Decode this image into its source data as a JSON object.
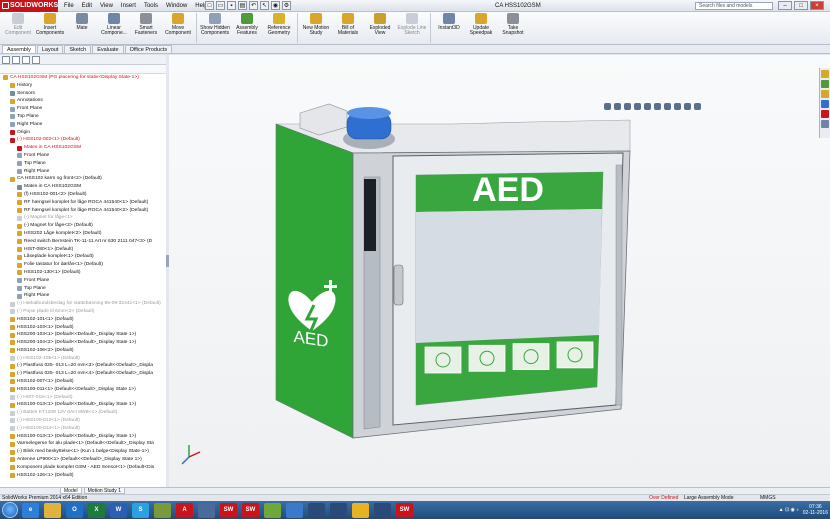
{
  "app": {
    "logo_text": "SOLIDWORKS",
    "document_title": "CA HSS102GSM",
    "search_placeholder": "Search files and models",
    "menus": [
      "File",
      "Edit",
      "View",
      "Insert",
      "Tools",
      "Window",
      "Help"
    ]
  },
  "ribbon": {
    "buttons": [
      {
        "label": "Edit Component",
        "icon": "edit-component-icon",
        "disabled": true,
        "color": "#c9ced6"
      },
      {
        "label": "Insert Components",
        "icon": "insert-components-icon",
        "disabled": false,
        "color": "#d9a52b"
      },
      {
        "label": "Mate",
        "icon": "mate-icon",
        "disabled": false,
        "color": "#7a8aa0"
      },
      {
        "label": "Linear Compone...",
        "icon": "linear-pattern-icon",
        "disabled": false,
        "color": "#6f86a8"
      },
      {
        "label": "Smart Fasteners",
        "icon": "smart-fasteners-icon",
        "disabled": false,
        "color": "#8a8f98"
      },
      {
        "label": "Move Component",
        "icon": "move-component-icon",
        "disabled": false,
        "color": "#d9a52b"
      },
      {
        "label": "Show Hidden Components",
        "icon": "show-hidden-icon",
        "disabled": false,
        "color": "#8fa0b8"
      },
      {
        "label": "Assembly Features",
        "icon": "assembly-features-icon",
        "disabled": false,
        "color": "#4f9a3a"
      },
      {
        "label": "Reference Geometry",
        "icon": "reference-geometry-icon",
        "disabled": false,
        "color": "#d9b22b"
      },
      {
        "label": "New Motion Study",
        "icon": "motion-study-icon",
        "disabled": false,
        "color": "#d9a52b"
      },
      {
        "label": "Bill of Materials",
        "icon": "bom-icon",
        "disabled": false,
        "color": "#d9a52b"
      },
      {
        "label": "Exploded View",
        "icon": "exploded-view-icon",
        "disabled": false,
        "color": "#c7a02f"
      },
      {
        "label": "Explode Line Sketch",
        "icon": "explode-line-icon",
        "disabled": true,
        "color": "#c9ced6"
      },
      {
        "label": "Instant3D",
        "icon": "instant3d-icon",
        "disabled": false,
        "color": "#6f86a8"
      },
      {
        "label": "Update Speedpak",
        "icon": "update-speedpak-icon",
        "disabled": false,
        "color": "#d9a52b"
      },
      {
        "label": "Take Snapshot",
        "icon": "snapshot-icon",
        "disabled": false,
        "color": "#8a8f98"
      }
    ]
  },
  "command_tabs": [
    "Assembly",
    "Layout",
    "Sketch",
    "Evaluate",
    "Office Products"
  ],
  "tree": [
    {
      "text": "CA HSS102GSM (PG placering for stativ<Display State-1>)",
      "style": "red",
      "indent": 0,
      "color": "#d9a52b"
    },
    {
      "text": "History",
      "style": "",
      "indent": 1,
      "color": "#d9a52b"
    },
    {
      "text": "Sensors",
      "style": "",
      "indent": 1,
      "color": "#7a8aa0"
    },
    {
      "text": "Annotations",
      "style": "",
      "indent": 1,
      "color": "#d9a52b"
    },
    {
      "text": "Front Plane",
      "style": "",
      "indent": 1,
      "color": "#8fa0b8"
    },
    {
      "text": "Top Plane",
      "style": "",
      "indent": 1,
      "color": "#8fa0b8"
    },
    {
      "text": "Right Plane",
      "style": "",
      "indent": 1,
      "color": "#8fa0b8"
    },
    {
      "text": "Origin",
      "style": "",
      "indent": 1,
      "color": "#c8141a"
    },
    {
      "text": "(-) HSS102-002<1> (Default)",
      "style": "red",
      "indent": 1,
      "color": "#c8141a"
    },
    {
      "text": "Mates in CA HSS102GSM",
      "style": "red",
      "indent": 2,
      "color": "#c8141a"
    },
    {
      "text": "Front Plane",
      "style": "",
      "indent": 2,
      "color": "#8fa0b8"
    },
    {
      "text": "Top Plane",
      "style": "",
      "indent": 2,
      "color": "#8fa0b8"
    },
    {
      "text": "Right Plane",
      "style": "",
      "indent": 2,
      "color": "#8fa0b8"
    },
    {
      "text": "CA HSS102 karm og front<2> (Default)",
      "style": "",
      "indent": 1,
      "color": "#d9a52b"
    },
    {
      "text": "Mates in CA HSS102GSM",
      "style": "",
      "indent": 2,
      "color": "#7a8aa0"
    },
    {
      "text": "(f) HSS102-001<2> (Default)",
      "style": "",
      "indent": 2,
      "color": "#d9a52b"
    },
    {
      "text": "RF hængsel komplet for låge ROCA 441540<1> (Default)",
      "style": "",
      "indent": 2,
      "color": "#d9a52b"
    },
    {
      "text": "RF hængsel komplet for låge ROCA 441540<2> (Default)",
      "style": "",
      "indent": 2,
      "color": "#d9a52b"
    },
    {
      "text": "(-) Magnet for låge<1>",
      "style": "gray",
      "indent": 2,
      "color": "#c9ced6"
    },
    {
      "text": "(-) Magnet for låge<2> (Default)",
      "style": "",
      "indent": 2,
      "color": "#d9a52b"
    },
    {
      "text": "HSS202 Låge komplet<2> (Default)",
      "style": "",
      "indent": 2,
      "color": "#d9a52b"
    },
    {
      "text": "Reed switch Bernstein TK-11-11 Art nr 630 2111 047<3> (D",
      "style": "",
      "indent": 2,
      "color": "#d9a52b"
    },
    {
      "text": "HIST-080<1> (Default)",
      "style": "",
      "indent": 2,
      "color": "#d9a52b"
    },
    {
      "text": "Låseplade komplet<1> (Default)",
      "style": "",
      "indent": 2,
      "color": "#d9a52b"
    },
    {
      "text": "Folie tastatur for dørlås<1> (Default)",
      "style": "",
      "indent": 2,
      "color": "#d9a52b"
    },
    {
      "text": "HSS102-130<1> (Default)",
      "style": "",
      "indent": 2,
      "color": "#d9a52b"
    },
    {
      "text": "Front Plane",
      "style": "",
      "indent": 2,
      "color": "#8fa0b8"
    },
    {
      "text": "Top Plane",
      "style": "",
      "indent": 2,
      "color": "#8fa0b8"
    },
    {
      "text": "Right Plane",
      "style": "",
      "indent": 2,
      "color": "#8fa0b8"
    },
    {
      "text": "(-) Hækalbundsbeslag for støttebøsning 95-09-32441<1> (Default)",
      "style": "gray",
      "indent": 1,
      "color": "#c9ced6"
    },
    {
      "text": "(-) Pojse plade til 6mm<2> (Default)",
      "style": "gray",
      "indent": 1,
      "color": "#c9ced6"
    },
    {
      "text": "HSS102-101<1> (Default)",
      "style": "",
      "indent": 1,
      "color": "#d9a52b"
    },
    {
      "text": "HSS102-103<1> (Default)",
      "style": "",
      "indent": 1,
      "color": "#d9a52b"
    },
    {
      "text": "HSS200-103<1> (Default<<Default>_Display State 1>)",
      "style": "",
      "indent": 1,
      "color": "#d9a52b"
    },
    {
      "text": "HSS200-104<2> (Default<<Default>_Display State 1>)",
      "style": "",
      "indent": 1,
      "color": "#d9a52b"
    },
    {
      "text": "HSS102-106<2> (Default)",
      "style": "",
      "indent": 1,
      "color": "#d9a52b"
    },
    {
      "text": "(-) HSS102-105<1> (Default)",
      "style": "gray",
      "indent": 1,
      "color": "#c9ced6"
    },
    {
      "text": "(-) Plastfuss 025- 013 L=20 mm<3> (Default<<Default>_Displa",
      "style": "",
      "indent": 1,
      "color": "#d9a52b"
    },
    {
      "text": "(-) Plastfuss 025- 013 L=20 mm<4> (Default<<Default>_Displa",
      "style": "",
      "indent": 1,
      "color": "#d9a52b"
    },
    {
      "text": "HSS102-007<1> (Default)",
      "style": "",
      "indent": 1,
      "color": "#d9a52b"
    },
    {
      "text": "HSS100-011<1> (Default<<Default>_Display State 1>)",
      "style": "",
      "indent": 1,
      "color": "#d9a52b"
    },
    {
      "text": "(-) HIST-015<1> (Default)",
      "style": "gray",
      "indent": 1,
      "color": "#c9ced6"
    },
    {
      "text": "HSS100-013<1> (Default<<Default>_Display State 1>)",
      "style": "",
      "indent": 1,
      "color": "#d9a52b"
    },
    {
      "text": "(-) Batteri KT1208 12V 0AH 8WB<1> (Default)",
      "style": "gray",
      "indent": 1,
      "color": "#c9ced6"
    },
    {
      "text": "(-) HSS100-012<1> (Default)",
      "style": "gray",
      "indent": 1,
      "color": "#c9ced6"
    },
    {
      "text": "(-) HSS100-014<1> (Default)",
      "style": "gray",
      "indent": 1,
      "color": "#c9ced6"
    },
    {
      "text": "HSS100-013<1> (Default<<Default>_Display State 1>)",
      "style": "",
      "indent": 1,
      "color": "#d9a52b"
    },
    {
      "text": "Varmelegeme for alu plade<1> (Default<<Default>_Display Sta",
      "style": "",
      "indent": 1,
      "color": "#d9a52b"
    },
    {
      "text": "(-) Blink med beskyttelse<1> (Kun 1 bølge<Display State-1>)",
      "style": "",
      "indent": 1,
      "color": "#d9a52b"
    },
    {
      "text": "Antenne LP900<1> (Default<<Default>_Display State 1>)",
      "style": "",
      "indent": 1,
      "color": "#d9a52b"
    },
    {
      "text": "Komponent plade komplet GSM - AED Sensor<1> (Default<Dis",
      "style": "",
      "indent": 1,
      "color": "#d9a52b"
    },
    {
      "text": "HSS102-126<1> (Default)",
      "style": "",
      "indent": 1,
      "color": "#d9a52b"
    }
  ],
  "model": {
    "door_sign": "AED",
    "side_sign": "AED",
    "accent_green": "#2fa537",
    "handle_blue": "#2f6fd1"
  },
  "bottom_tabs": [
    "Model",
    "Motion Study 1"
  ],
  "status": {
    "edition": "SolidWorks Premium 2014 x64 Edition",
    "defined": "Over Defined",
    "mode": "Large Assembly Mode",
    "units": "MMGS"
  },
  "taskbar": {
    "time": "07:36",
    "date": "02-11-2016",
    "apps": [
      {
        "name": "ie-icon",
        "color": "#2e7fd8",
        "glyph": "e"
      },
      {
        "name": "explorer-icon",
        "color": "#e2b33c",
        "glyph": ""
      },
      {
        "name": "outlook-icon",
        "color": "#1f6fc5",
        "glyph": "O"
      },
      {
        "name": "excel-icon",
        "color": "#1f7a3d",
        "glyph": "X"
      },
      {
        "name": "word-icon",
        "color": "#2b5fb3",
        "glyph": "W"
      },
      {
        "name": "skype-icon",
        "color": "#2aa1e0",
        "glyph": "S"
      },
      {
        "name": "chart-app-icon",
        "color": "#7a9a3a",
        "glyph": ""
      },
      {
        "name": "acrobat-icon",
        "color": "#c8141a",
        "glyph": "A"
      },
      {
        "name": "app-icon",
        "color": "#4a6a9a",
        "glyph": ""
      },
      {
        "name": "solidworks-icon",
        "color": "#c8141a",
        "glyph": "SW"
      },
      {
        "name": "solidworks-icon-2",
        "color": "#c8141a",
        "glyph": "SW"
      },
      {
        "name": "paint-icon",
        "color": "#6fa83a",
        "glyph": ""
      },
      {
        "name": "tool-icon",
        "color": "#3a7ac8",
        "glyph": ""
      },
      {
        "name": "stats-icon",
        "color": "#2a4a7a",
        "glyph": ""
      },
      {
        "name": "stats-icon-2",
        "color": "#2a4a7a",
        "glyph": ""
      },
      {
        "name": "chrome-icon",
        "color": "#e8b322",
        "glyph": ""
      },
      {
        "name": "app-icon-2",
        "color": "#2a4a7a",
        "glyph": ""
      },
      {
        "name": "solidworks-icon-3",
        "color": "#c8141a",
        "glyph": "SW"
      }
    ]
  }
}
